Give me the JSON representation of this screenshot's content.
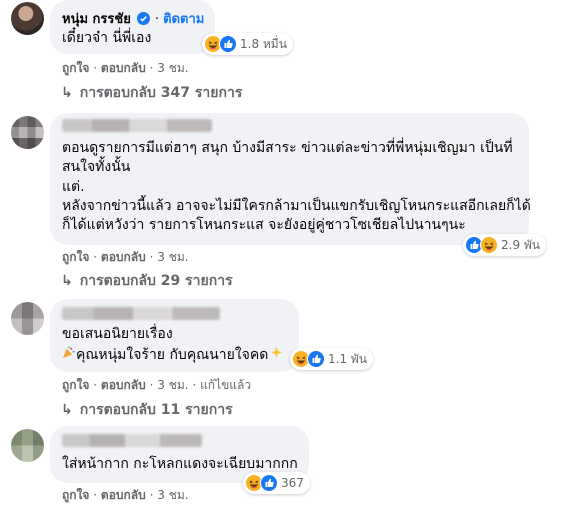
{
  "comments": [
    {
      "author": "หนุ่ม กรรชัย",
      "verified": true,
      "follow_label": "ติดตาม",
      "lines": [
        "เดี๋ยวจ๋า นี่พี่เอง"
      ],
      "reaction_count": "1.8 หมื่น",
      "reaction_icons": [
        "haha-icon",
        "like-icon"
      ],
      "like_label": "ถูกใจ",
      "reply_label": "ตอบกลับ",
      "time": "3 ชม.",
      "replies_label": "การตอบกลับ 347 รายการ"
    },
    {
      "author": "",
      "lines": [
        "ตอนดูรายการมีแต่ฮาๆ สนุก บ้างมีสาระ ข่าวแต่ละข่าวที่พี่หนุ่มเชิญมา เป็นที่",
        "สนใจทั้งนั้น",
        "แต่.",
        "หลังจากข่าวนี้แล้ว อาจจะไม่มีใครกล้ามาเป็นแขกรับเชิญโหนกระแสอีกเลยก็ได้",
        "ก็ได้แต่หวังว่า รายการโหนกระแส จะยังอยู่คู่ชาวโซเชียลไปนานๆนะ"
      ],
      "reaction_count": "2.9 พัน",
      "reaction_icons": [
        "like-icon",
        "haha-icon"
      ],
      "like_label": "ถูกใจ",
      "reply_label": "ตอบกลับ",
      "time": "3 ชม.",
      "replies_label": "การตอบกลับ 29 รายการ"
    },
    {
      "author": "",
      "lines": [
        "ขอเสนอนิยายเรื่อง",
        "คุณหนุ่มใจร้าย กับคุณนายใจคด"
      ],
      "reaction_count": "1.1 พัน",
      "reaction_icons": [
        "haha-icon",
        "like-icon"
      ],
      "like_label": "ถูกใจ",
      "reply_label": "ตอบกลับ",
      "time": "3 ชม.",
      "edited_label": "แก้ไขแล้ว",
      "replies_label": "การตอบกลับ 11 รายการ"
    },
    {
      "author": "",
      "lines": [
        "ใส่หน้ากาก กะโหลกแดงจะเฉียบมากกก"
      ],
      "reaction_count": "367",
      "reaction_icons": [
        "haha-icon",
        "like-icon"
      ],
      "like_label": "ถูกใจ",
      "reply_label": "ตอบกลับ",
      "time": "3 ชม."
    }
  ],
  "colors": {
    "bubble": "#f0f2f5",
    "meta": "#65676b",
    "link": "#1877f2",
    "like": "#1877f2",
    "haha": "#f7b125"
  },
  "separator": "·"
}
